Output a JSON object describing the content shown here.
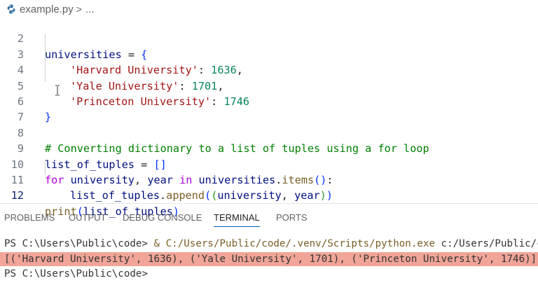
{
  "breadcrumb": {
    "file_name": "example.py",
    "separator": ">",
    "more": "..."
  },
  "editor": {
    "line_numbers": [
      "2",
      "3",
      "4",
      "5",
      "6",
      "7",
      "8",
      "9",
      "10",
      "11",
      "12"
    ],
    "active_line": "12",
    "code": {
      "l2": {
        "var": "universities",
        "op": " = ",
        "brace": "{"
      },
      "l3": {
        "key": "'Harvard University'",
        "colon": ": ",
        "value": "1636",
        "comma": ","
      },
      "l4": {
        "key": "'Yale University'",
        "colon": ": ",
        "value": "1701",
        "comma": ","
      },
      "l5": {
        "key": "'Princeton University'",
        "colon": ": ",
        "value": "1746"
      },
      "l6": {
        "brace": "}"
      },
      "l8": {
        "comment": "# Converting dictionary to a list of tuples using a for loop"
      },
      "l9": {
        "var": "list_of_tuples",
        "op": " = ",
        "brackets": "[]"
      },
      "l10": {
        "kw_for": "for",
        "var1": "university",
        "comma": ", ",
        "var2": "year",
        "kw_in": "in",
        "var3": "universities",
        "dot": ".",
        "fn": "items",
        "parens": "()",
        "colon": ":"
      },
      "l11": {
        "var": "list_of_tuples",
        "dot": ".",
        "fn": "append",
        "open1": "(",
        "open2": "(",
        "arg1": "university",
        "comma": ", ",
        "arg2": "year",
        "close2": ")",
        "close1": ")"
      },
      "l12": {
        "fn": "print",
        "open": "(",
        "arg": "list_of_tuples",
        "close": ")"
      }
    }
  },
  "panel": {
    "tabs": [
      "PROBLEMS",
      "OUTPUT",
      "DEBUG CONSOLE",
      "TERMINAL",
      "PORTS"
    ],
    "active_tab": "TERMINAL"
  },
  "terminal": {
    "line1_prompt": "PS C:\\Users\\Public\\code> ",
    "line1_amp": "& ",
    "line1_exe": "C:/Users/Public/code/.venv/Scripts/python.exe",
    "line1_arg": " c:/Users/Public/c",
    "line2_output": "[('Harvard University', 1636), ('Yale University', 1701), ('Princeton University', 1746)]",
    "line3_prompt": "PS C:\\Users\\Public\\code>"
  },
  "colors": {
    "keyword": "#0000ff",
    "control_keyword": "#af00db",
    "variable": "#001080",
    "function": "#795e26",
    "string": "#a31515",
    "number": "#098658",
    "comment": "#008000",
    "output_highlight": "#f0a598",
    "active_tab_underline": "#005fb8"
  }
}
